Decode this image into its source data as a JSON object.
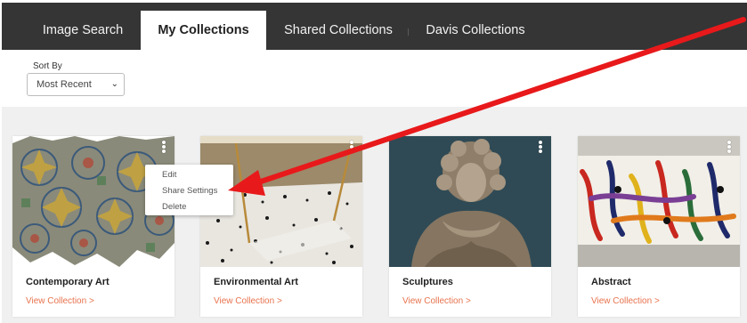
{
  "nav": {
    "tabs": [
      {
        "label": "Image Search",
        "active": false
      },
      {
        "label": "My Collections",
        "active": true
      },
      {
        "label": "Shared Collections",
        "active": false
      },
      {
        "label": "Davis Collections",
        "active": false
      }
    ]
  },
  "sort": {
    "label": "Sort By",
    "selected": "Most Recent"
  },
  "menu": {
    "items": [
      "Edit",
      "Share Settings",
      "Delete"
    ]
  },
  "cards": [
    {
      "title": "Contemporary Art",
      "link": "View Collection >"
    },
    {
      "title": "Environmental Art",
      "link": "View Collection >"
    },
    {
      "title": "Sculptures",
      "link": "View Collection >"
    },
    {
      "title": "Abstract",
      "link": "View Collection >"
    }
  ],
  "colors": {
    "navbar": "#353535",
    "link": "#e8734e",
    "annotation_arrow": "#e8191b"
  },
  "icons": {
    "dots": "vertical-dots-icon",
    "select": "chevron-down-icon"
  }
}
